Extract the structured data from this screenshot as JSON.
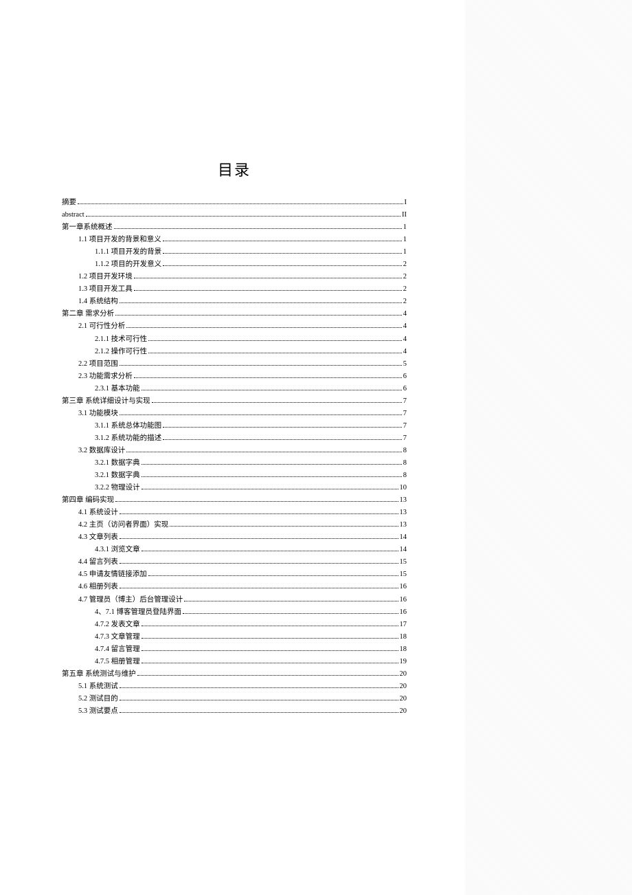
{
  "title": "目录",
  "toc": [
    {
      "label": "摘要",
      "page": "I",
      "level": 0
    },
    {
      "label": "abstract",
      "page": "II",
      "level": 0
    },
    {
      "label": "第一章系统概述",
      "page": "1",
      "level": 0
    },
    {
      "label": "1.1 项目开发的背景和意义",
      "page": "1",
      "level": 1
    },
    {
      "label": "1.1.1 项目开发的背景",
      "page": "1",
      "level": 2
    },
    {
      "label": "1.1.2  项目的开发意义",
      "page": "2",
      "level": 2
    },
    {
      "label": "1.2 项目开发环境",
      "page": "2",
      "level": 1
    },
    {
      "label": "1.3 项目开发工具",
      "page": "2",
      "level": 1
    },
    {
      "label": "1.4 系统结构",
      "page": "2",
      "level": 1
    },
    {
      "label": "第二章  需求分析",
      "page": "4",
      "level": 0
    },
    {
      "label": "2.1 可行性分析",
      "page": "4",
      "level": 1
    },
    {
      "label": "2.1.1 技术可行性",
      "page": "4",
      "level": 2
    },
    {
      "label": "2.1.2 操作可行性",
      "page": "4",
      "level": 2
    },
    {
      "label": "2.2 项目范围",
      "page": "5",
      "level": 1
    },
    {
      "label": "2.3 功能需求分析",
      "page": "6",
      "level": 1
    },
    {
      "label": "2.3.1 基本功能",
      "page": "6",
      "level": 2
    },
    {
      "label": "第三章  系统详细设计与实现",
      "page": "7",
      "level": 0
    },
    {
      "label": "3.1 功能模块",
      "page": "7",
      "level": 1
    },
    {
      "label": "3.1.1 系统总体功能图",
      "page": "7",
      "level": 2
    },
    {
      "label": "3.1.2 系统功能的描述",
      "page": "7",
      "level": 2
    },
    {
      "label": "3.2 数据库设计",
      "page": "8",
      "level": 1
    },
    {
      "label": "3.2.1 数据字典",
      "page": "8",
      "level": 2
    },
    {
      "label": "3.2.1 数据字典",
      "page": "8",
      "level": 2
    },
    {
      "label": "3.2.2 物理设计",
      "page": "10",
      "level": 2
    },
    {
      "label": "第四章  编码实现",
      "page": "13",
      "level": 0
    },
    {
      "label": "4.1 系统设计",
      "page": "13",
      "level": 1
    },
    {
      "label": "4.2 主页（访问者界面）实现",
      "page": "13",
      "level": 1
    },
    {
      "label": "4.3 文章列表",
      "page": "14",
      "level": 1
    },
    {
      "label": "4.3.1 浏览文章",
      "page": "14",
      "level": 2
    },
    {
      "label": "4.4 留言列表",
      "page": "15",
      "level": 1
    },
    {
      "label": "4.5 申请友情链接添加",
      "page": "15",
      "level": 1
    },
    {
      "label": "4.6 相册列表",
      "page": "16",
      "level": 1
    },
    {
      "label": "4.7 管理员（博主）后台管理设计",
      "page": "16",
      "level": 1
    },
    {
      "label": "4、7.1 博客管理员登陆界面",
      "page": "16",
      "level": 2
    },
    {
      "label": "4.7.2 发表文章",
      "page": "17",
      "level": 2
    },
    {
      "label": "4.7.3 文章管理",
      "page": "18",
      "level": 2
    },
    {
      "label": "4.7.4 留言管理",
      "page": "18",
      "level": 2
    },
    {
      "label": "4.7.5 相册管理",
      "page": "19",
      "level": 2
    },
    {
      "label": "第五章  系统测试与维护",
      "page": "20",
      "level": 0
    },
    {
      "label": "5.1 系统测试",
      "page": "20",
      "level": 1
    },
    {
      "label": "5.2 测试目的",
      "page": "20",
      "level": 1
    },
    {
      "label": "5.3 测试要点",
      "page": "20",
      "level": 1
    }
  ]
}
